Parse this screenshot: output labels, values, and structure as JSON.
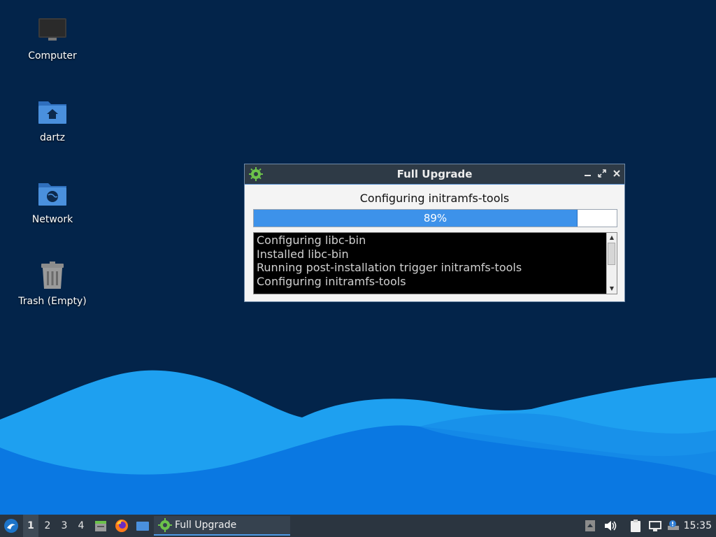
{
  "desktop": {
    "icons": [
      {
        "label": "Computer"
      },
      {
        "label": "dartz"
      },
      {
        "label": "Network"
      },
      {
        "label": "Trash (Empty)"
      }
    ]
  },
  "dialog": {
    "title": "Full Upgrade",
    "status": "Configuring initramfs-tools",
    "progress_percent": 89,
    "progress_label": "89%",
    "log_lines": [
      "Configuring libc-bin",
      "Installed libc-bin",
      "Running post-installation trigger initramfs-tools",
      "Configuring initramfs-tools"
    ]
  },
  "taskbar": {
    "workspaces": [
      "1",
      "2",
      "3",
      "4"
    ],
    "active_workspace": "1",
    "task_label": "Full Upgrade",
    "clock": "15:35",
    "launchers": [
      "file-manager-icon",
      "firefox-icon",
      "desktop-icon"
    ],
    "tray": [
      "arrow-up-icon",
      "volume-icon",
      "clipboard-icon",
      "network-icon",
      "update-notifier-icon"
    ]
  },
  "colors": {
    "wallpaper_bg": "#03244a",
    "wave_light": "#1ea0f0",
    "wave_mid": "#0a74e0",
    "progress_fill": "#3d92ea",
    "taskbar_bg": "#2b3540"
  }
}
